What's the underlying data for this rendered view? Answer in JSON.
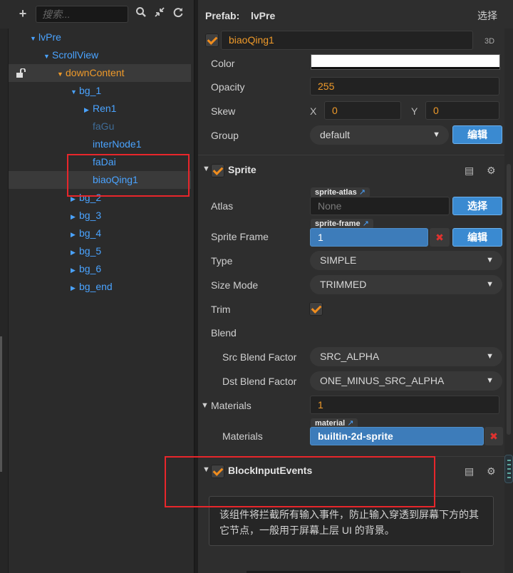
{
  "hierarchy": {
    "search_placeholder": "搜索...",
    "nodes": [
      {
        "label": "lvPre",
        "expanded": true,
        "color": "#4aa3ff"
      },
      {
        "label": "ScrollView",
        "expanded": true,
        "color": "#4aa3ff"
      },
      {
        "label": "downContent",
        "expanded": true,
        "color": "#ef9a2a"
      },
      {
        "label": "bg_1",
        "expanded": true,
        "color": "#4aa3ff"
      },
      {
        "label": "Ren1",
        "expanded": false,
        "color": "#4aa3ff"
      },
      {
        "label": "faGu",
        "color": "#3f6c98"
      },
      {
        "label": "interNode1",
        "color": "#4aa3ff"
      },
      {
        "label": "faDai",
        "color": "#4aa3ff"
      },
      {
        "label": "biaoQing1",
        "color": "#4aa3ff"
      },
      {
        "label": "bg_2",
        "expanded": false,
        "color": "#4aa3ff"
      },
      {
        "label": "bg_3",
        "expanded": false,
        "color": "#4aa3ff"
      },
      {
        "label": "bg_4",
        "expanded": false,
        "color": "#4aa3ff"
      },
      {
        "label": "bg_5",
        "expanded": false,
        "color": "#4aa3ff"
      },
      {
        "label": "bg_6",
        "expanded": false,
        "color": "#4aa3ff"
      },
      {
        "label": "bg_end",
        "expanded": false,
        "color": "#4aa3ff"
      }
    ]
  },
  "inspector": {
    "prefab_label": "Prefab:",
    "prefab_name": "lvPre",
    "prefab_select": "选择",
    "node_name": "biaoQing1",
    "node_3d": "3D",
    "color_label": "Color",
    "color_value": "#ffffff",
    "opacity_label": "Opacity",
    "opacity_value": "255",
    "skew_label": "Skew",
    "skew_x_label": "X",
    "skew_x": "0",
    "skew_y_label": "Y",
    "skew_y": "0",
    "group_label": "Group",
    "group_value": "default",
    "group_edit": "编辑",
    "sprite": {
      "title": "Sprite",
      "atlas_label": "Atlas",
      "atlas_tag": "sprite-atlas",
      "atlas_value": "None",
      "atlas_select": "选择",
      "frame_label": "Sprite Frame",
      "frame_tag": "sprite-frame",
      "frame_value": "1",
      "frame_edit": "编辑",
      "type_label": "Type",
      "type_value": "SIMPLE",
      "size_mode_label": "Size Mode",
      "size_mode_value": "TRIMMED",
      "trim_label": "Trim",
      "blend_label": "Blend",
      "src_label": "Src Blend Factor",
      "src_value": "SRC_ALPHA",
      "dst_label": "Dst Blend Factor",
      "dst_value": "ONE_MINUS_SRC_ALPHA",
      "materials_label": "Materials",
      "materials_count": "1",
      "material_tag": "material",
      "material_item_label": "Materials",
      "material_value": "builtin-2d-sprite"
    },
    "block": {
      "title": "BlockInputEvents",
      "description": "该组件将拦截所有输入事件，防止输入穿透到屏幕下方的其它节点，一般用于屏幕上层 UI 的背景。"
    }
  },
  "colors": {
    "accent": "#ef9a2a",
    "link": "#4aa3ff",
    "button": "#3a8ad1",
    "highlight": "#e8262b"
  }
}
